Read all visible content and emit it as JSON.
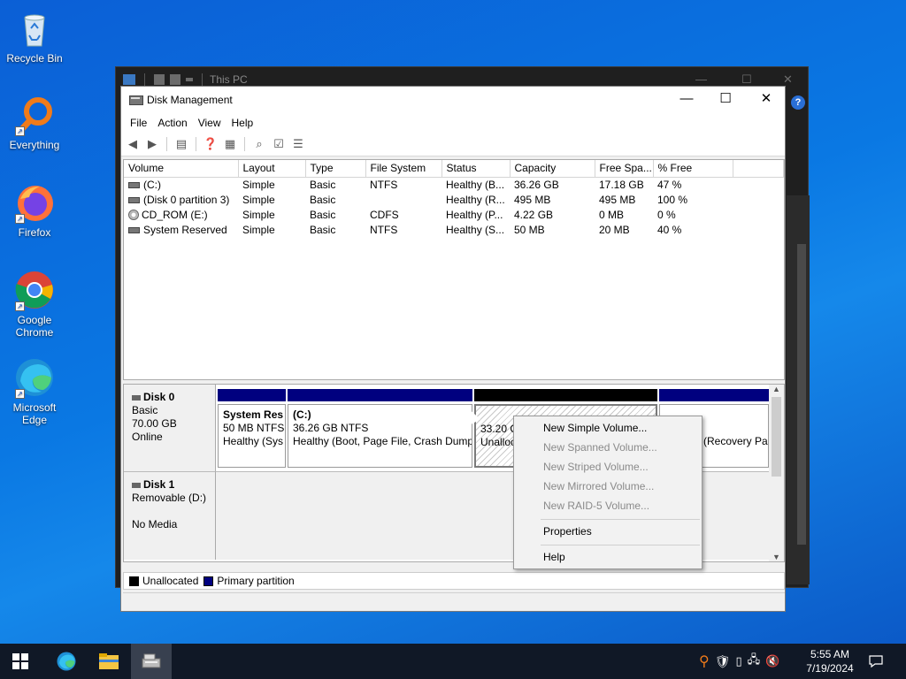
{
  "desktop": {
    "icons": [
      {
        "label": "Recycle Bin",
        "icon": "recycle-bin-icon"
      },
      {
        "label": "Everything",
        "icon": "everything-search-icon"
      },
      {
        "label": "Firefox",
        "icon": "firefox-icon"
      },
      {
        "label": "Google Chrome",
        "icon": "chrome-icon"
      },
      {
        "label": "Microsoft Edge",
        "icon": "edge-icon"
      }
    ]
  },
  "explorer": {
    "title": "This PC",
    "help_glyph": "?"
  },
  "window": {
    "title": "Disk Management",
    "controls": {
      "minimize": "—",
      "maximize": "☐",
      "close": "✕"
    }
  },
  "menu": [
    "File",
    "Action",
    "View",
    "Help"
  ],
  "volume_table": {
    "columns": [
      "Volume",
      "Layout",
      "Type",
      "File System",
      "Status",
      "Capacity",
      "Free Spa...",
      "% Free"
    ],
    "rows": [
      {
        "volume": "(C:)",
        "layout": "Simple",
        "type": "Basic",
        "fs": "NTFS",
        "status": "Healthy (B...",
        "capacity": "36.26 GB",
        "free": "17.18 GB",
        "pct": "47 %",
        "icon": "drive-icon"
      },
      {
        "volume": "(Disk 0 partition 3)",
        "layout": "Simple",
        "type": "Basic",
        "fs": "",
        "status": "Healthy (R...",
        "capacity": "495 MB",
        "free": "495 MB",
        "pct": "100 %",
        "icon": "drive-icon"
      },
      {
        "volume": "CD_ROM (E:)",
        "layout": "Simple",
        "type": "Basic",
        "fs": "CDFS",
        "status": "Healthy (P...",
        "capacity": "4.22 GB",
        "free": "0 MB",
        "pct": "0 %",
        "icon": "cd-icon"
      },
      {
        "volume": "System Reserved",
        "layout": "Simple",
        "type": "Basic",
        "fs": "NTFS",
        "status": "Healthy (S...",
        "capacity": "50 MB",
        "free": "20 MB",
        "pct": "40 %",
        "icon": "drive-icon"
      }
    ]
  },
  "disks": {
    "disk0": {
      "name": "Disk 0",
      "type": "Basic",
      "size": "70.00 GB",
      "state": "Online"
    },
    "disk1": {
      "name": "Disk 1",
      "type": "Removable (D:)",
      "state": "No Media"
    }
  },
  "partitions": {
    "system_reserved": {
      "name": "System Res",
      "size": "50 MB NTFS",
      "status": "Healthy (Sys"
    },
    "c": {
      "name": "(C:)",
      "size": "36.26 GB NTFS",
      "status": "Healthy (Boot, Page File, Crash Dump"
    },
    "unalloc": {
      "size": "33.20 G",
      "status": "Unalloc"
    },
    "recovery": {
      "status": "(Recovery Pa"
    }
  },
  "legend": {
    "unallocated": "Unallocated",
    "primary": "Primary partition"
  },
  "colors": {
    "unallocated": "#000000",
    "primary": "#00007f"
  },
  "context_menu": {
    "new_simple": "New Simple Volume...",
    "new_spanned": "New Spanned Volume...",
    "new_striped": "New Striped Volume...",
    "new_mirrored": "New Mirrored Volume...",
    "new_raid5": "New RAID-5 Volume...",
    "properties": "Properties",
    "help": "Help"
  },
  "taskbar": {
    "time": "5:55 AM",
    "date": "7/19/2024"
  }
}
